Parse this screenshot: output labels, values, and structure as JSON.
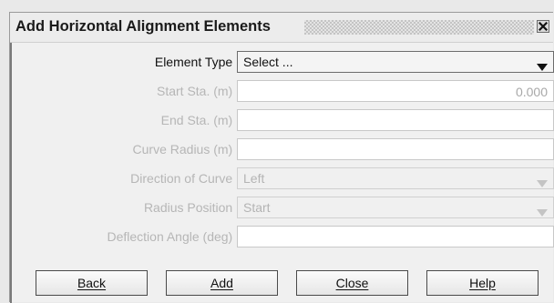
{
  "dialog": {
    "title": "Add Horizontal Alignment Elements",
    "close_icon": "close-icon"
  },
  "form": {
    "element_type": {
      "label": "Element Type :",
      "value": "Select ...",
      "enabled": true
    },
    "start_sta": {
      "label": "Start Sta. (m) :",
      "value": "0.000",
      "enabled": false
    },
    "end_sta": {
      "label": "End Sta. (m) :",
      "value": "",
      "enabled": false
    },
    "curve_radius": {
      "label": "Curve Radius (m) :",
      "value": "",
      "enabled": false
    },
    "direction_of_curve": {
      "label": "Direction of Curve :",
      "value": "Left",
      "enabled": false
    },
    "radius_position": {
      "label": "Radius Position :",
      "value": "Start",
      "enabled": false
    },
    "deflection_angle": {
      "label": "Deflection Angle (deg) :",
      "value": "",
      "enabled": false
    }
  },
  "buttons": {
    "back": "Back",
    "add": "Add",
    "close": "Close",
    "help": "Help"
  },
  "colors": {
    "dialog_bg": "#f0f0f0",
    "disabled_text": "#b6b6b6",
    "enabled_text": "#111111"
  }
}
